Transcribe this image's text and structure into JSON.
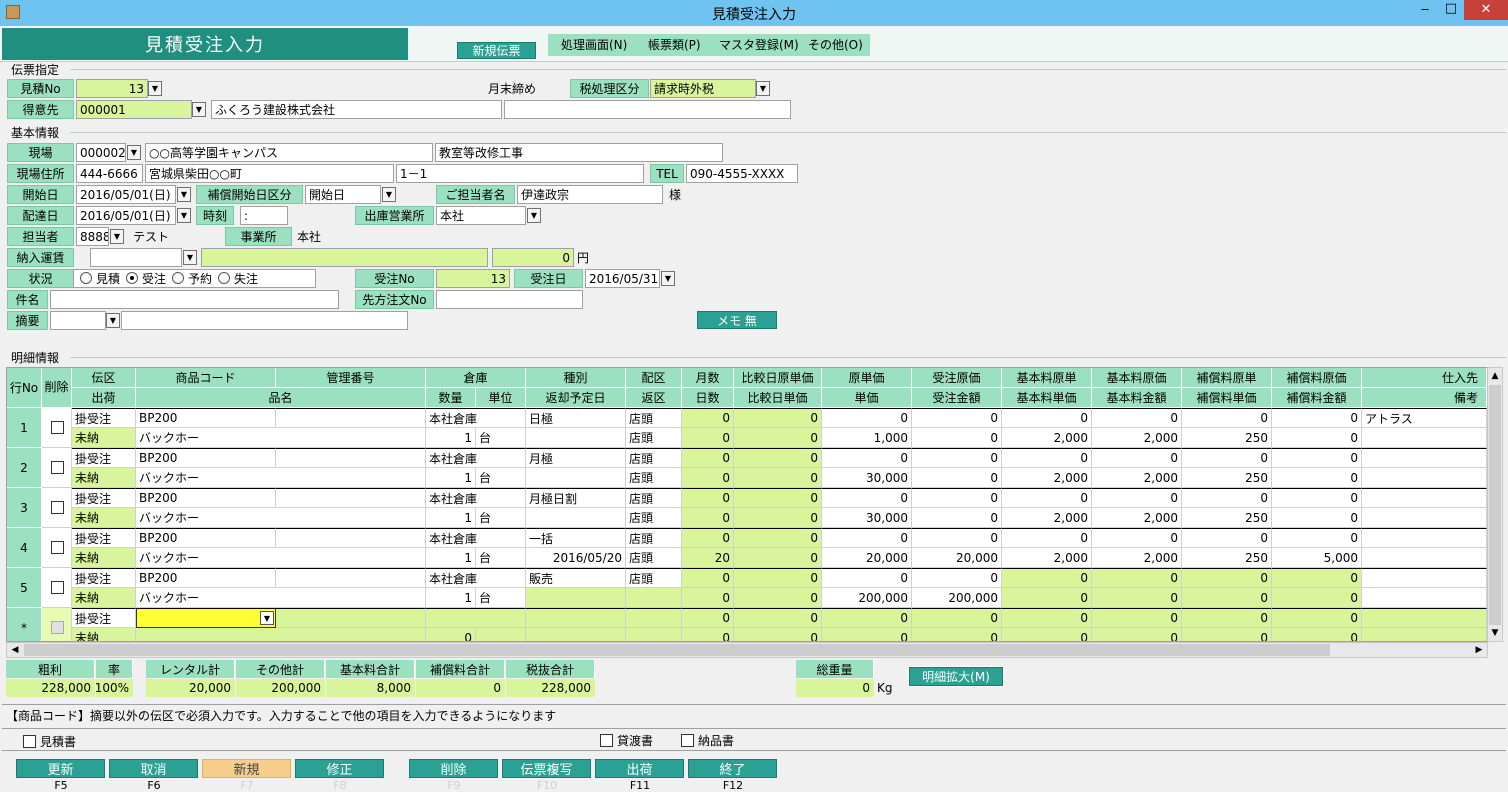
{
  "window": {
    "title": "見積受注入力",
    "minimize": "‒",
    "maximize": "□",
    "close": "✕"
  },
  "header": {
    "title": "見積受注入力",
    "new_slip_label": "新規伝票",
    "menus": [
      "処理画面(N)",
      "帳票類(P)",
      "マスタ登録(M)",
      "その他(O)"
    ]
  },
  "slip": {
    "group_label": "伝票指定",
    "est_no_label": "見積No",
    "est_no": "13",
    "month_end": "月末締め",
    "tax_label": "税処理区分",
    "tax_value": "請求時外税",
    "customer_label": "得意先",
    "customer_code": "000001",
    "customer_name": "ふくろう建設株式会社",
    "customer_extra": ""
  },
  "basic": {
    "group_label": "基本情報",
    "site_label": "現場",
    "site_code": "000002",
    "site_name": "○○高等学園キャンパス",
    "site_desc": "教室等改修工事",
    "addr_label": "現場住所",
    "zip": "444-6666",
    "addr1": "宮城県柴田○○町",
    "addr2": "1－1",
    "tel_label": "TEL",
    "tel": "090-4555-XXXX",
    "start_label": "開始日",
    "start_date": "2016/05/01(日)",
    "comp_start_label": "補償開始日区分",
    "comp_start": "開始日",
    "contact_label": "ご担当者名",
    "contact": "伊達政宗",
    "sama": "様",
    "delivery_label": "配達日",
    "delivery_date": "2016/05/01(日)",
    "time_label": "時刻",
    "time": " :",
    "office_label": "出庫営業所",
    "office": "本社",
    "staff_label": "担当者",
    "staff_code": "8888",
    "staff_name": "テスト",
    "branch_label": "事業所",
    "branch": "本社",
    "freight_label": "納入運賃",
    "freight": "0",
    "yen": "円",
    "status_label": "状況",
    "status_options": [
      "見積",
      "受注",
      "予約",
      "失注"
    ],
    "order_no_label": "受注No",
    "order_no": "13",
    "order_date_label": "受注日",
    "order_date": "2016/05/31",
    "subject_label": "件名",
    "subject": "",
    "cust_order_label": "先方注文No",
    "cust_order": "",
    "summary_label": "摘要",
    "summary": "",
    "memo_button": "メモ 無"
  },
  "detail": {
    "group_label": "明細情報",
    "headers_top": [
      "行No",
      "削除",
      "伝区",
      "商品コード",
      "管理番号",
      "倉庫",
      "種別",
      "配区",
      "月数",
      "比較日原単価",
      "原単価",
      "受注原価",
      "基本料原単",
      "基本料原価",
      "補償料原単",
      "補償料原価",
      "仕入先"
    ],
    "headers_bottom": [
      "出荷",
      "品名",
      "数量",
      "単位",
      "返却予定日",
      "返区",
      "日数",
      "比較日単価",
      "単価",
      "受注金額",
      "基本料単価",
      "基本料金額",
      "補償料単価",
      "補償料金額",
      "備考"
    ],
    "rows": [
      {
        "no": "1",
        "kubun": "掛受注",
        "ship": "未納",
        "code": "BP200",
        "name": "バックホー",
        "wh": "本社倉庫",
        "qty": "1",
        "unit": "台",
        "kind": "日極",
        "ret_date": "",
        "hai": "店頭",
        "hen": "店頭",
        "months": "0",
        "days": "0",
        "cmp_cost": "0",
        "cmp_price": "0",
        "cost": "0",
        "price": "1,000",
        "ord_cost": "0",
        "ord_amt": "0",
        "base_cost": "0",
        "base_price": "2,000",
        "base_costsum": "0",
        "base_amt": "2,000",
        "comp_cost": "0",
        "comp_price": "250",
        "comp_costsum": "0",
        "comp_amt": "0",
        "supplier": "アトラス",
        "note": ""
      },
      {
        "no": "2",
        "kubun": "掛受注",
        "ship": "未納",
        "code": "BP200",
        "name": "バックホー",
        "wh": "本社倉庫",
        "qty": "1",
        "unit": "台",
        "kind": "月極",
        "ret_date": "",
        "hai": "店頭",
        "hen": "店頭",
        "months": "0",
        "days": "0",
        "cmp_cost": "0",
        "cmp_price": "0",
        "cost": "0",
        "price": "30,000",
        "ord_cost": "0",
        "ord_amt": "0",
        "base_cost": "0",
        "base_price": "2,000",
        "base_costsum": "0",
        "base_amt": "2,000",
        "comp_cost": "0",
        "comp_price": "250",
        "comp_costsum": "0",
        "comp_amt": "0",
        "supplier": "",
        "note": ""
      },
      {
        "no": "3",
        "kubun": "掛受注",
        "ship": "未納",
        "code": "BP200",
        "name": "バックホー",
        "wh": "本社倉庫",
        "qty": "1",
        "unit": "台",
        "kind": "月極日割",
        "ret_date": "",
        "hai": "店頭",
        "hen": "店頭",
        "months": "0",
        "days": "0",
        "cmp_cost": "0",
        "cmp_price": "0",
        "cost": "0",
        "price": "30,000",
        "ord_cost": "0",
        "ord_amt": "0",
        "base_cost": "0",
        "base_price": "2,000",
        "base_costsum": "0",
        "base_amt": "2,000",
        "comp_cost": "0",
        "comp_price": "250",
        "comp_costsum": "0",
        "comp_amt": "0",
        "supplier": "",
        "note": ""
      },
      {
        "no": "4",
        "kubun": "掛受注",
        "ship": "未納",
        "code": "BP200",
        "name": "バックホー",
        "wh": "本社倉庫",
        "qty": "1",
        "unit": "台",
        "kind": "一括",
        "ret_date": "2016/05/20",
        "hai": "店頭",
        "hen": "店頭",
        "months": "0",
        "days": "20",
        "cmp_cost": "0",
        "cmp_price": "0",
        "cost": "0",
        "price": "20,000",
        "ord_cost": "0",
        "ord_amt": "20,000",
        "base_cost": "0",
        "base_price": "2,000",
        "base_costsum": "0",
        "base_amt": "2,000",
        "comp_cost": "0",
        "comp_price": "250",
        "comp_costsum": "0",
        "comp_amt": "5,000",
        "supplier": "",
        "note": ""
      },
      {
        "no": "5",
        "kubun": "掛受注",
        "ship": "未納",
        "code": "BP200",
        "name": "バックホー",
        "wh": "本社倉庫",
        "qty": "1",
        "unit": "台",
        "kind": "販売",
        "ret_date": "",
        "hai": "店頭",
        "hen": "",
        "months": "0",
        "days": "0",
        "cmp_cost": "0",
        "cmp_price": "0",
        "cost": "0",
        "price": "200,000",
        "ord_cost": "0",
        "ord_amt": "200,000",
        "base_cost": "0",
        "base_price": "0",
        "base_costsum": "0",
        "base_amt": "0",
        "comp_cost": "0",
        "comp_price": "0",
        "comp_costsum": "0",
        "comp_amt": "0",
        "supplier": "",
        "note": ""
      },
      {
        "no": "*",
        "kubun": "掛受注",
        "ship": "未納",
        "code": "",
        "name": "",
        "wh": "",
        "qty": "0",
        "unit": "",
        "kind": "",
        "ret_date": "",
        "hai": "",
        "hen": "",
        "months": "0",
        "days": "0",
        "cmp_cost": "0",
        "cmp_price": "0",
        "cost": "0",
        "price": "0",
        "ord_cost": "0",
        "ord_amt": "0",
        "base_cost": "0",
        "base_price": "0",
        "base_costsum": "0",
        "base_amt": "0",
        "comp_cost": "0",
        "comp_price": "0",
        "comp_costsum": "0",
        "comp_amt": "0",
        "supplier": "",
        "note": ""
      }
    ]
  },
  "totals": {
    "profit_label": "粗利",
    "profit": "228,000",
    "rate_label": "率",
    "rate": "100%",
    "rental_label": "レンタル計",
    "rental": "20,000",
    "other_label": "その他計",
    "other": "200,000",
    "base_label": "基本料合計",
    "base": "8,000",
    "comp_label": "補償料合計",
    "comp": "0",
    "pretax_label": "税抜合計",
    "pretax": "228,000",
    "weight_label": "総重量",
    "weight": "0",
    "weight_unit": "Kg",
    "expand_button": "明細拡大(M)"
  },
  "hint": "【商品コード】摘要以外の伝区で必須入力です。入力することで他の項目を入力できるようになります",
  "prints": {
    "estimate": "見積書",
    "loan": "貸渡書",
    "delivery": "納品書"
  },
  "fkeys": [
    {
      "label": "更新",
      "key": "F5"
    },
    {
      "label": "取消",
      "key": "F6"
    },
    {
      "label": "新規",
      "key": "F7"
    },
    {
      "label": "修正",
      "key": "F8"
    },
    {
      "label": "削除",
      "key": "F9"
    },
    {
      "label": "伝票複写",
      "key": "F10"
    },
    {
      "label": "出荷",
      "key": "F11"
    },
    {
      "label": "終了",
      "key": "F12"
    }
  ]
}
